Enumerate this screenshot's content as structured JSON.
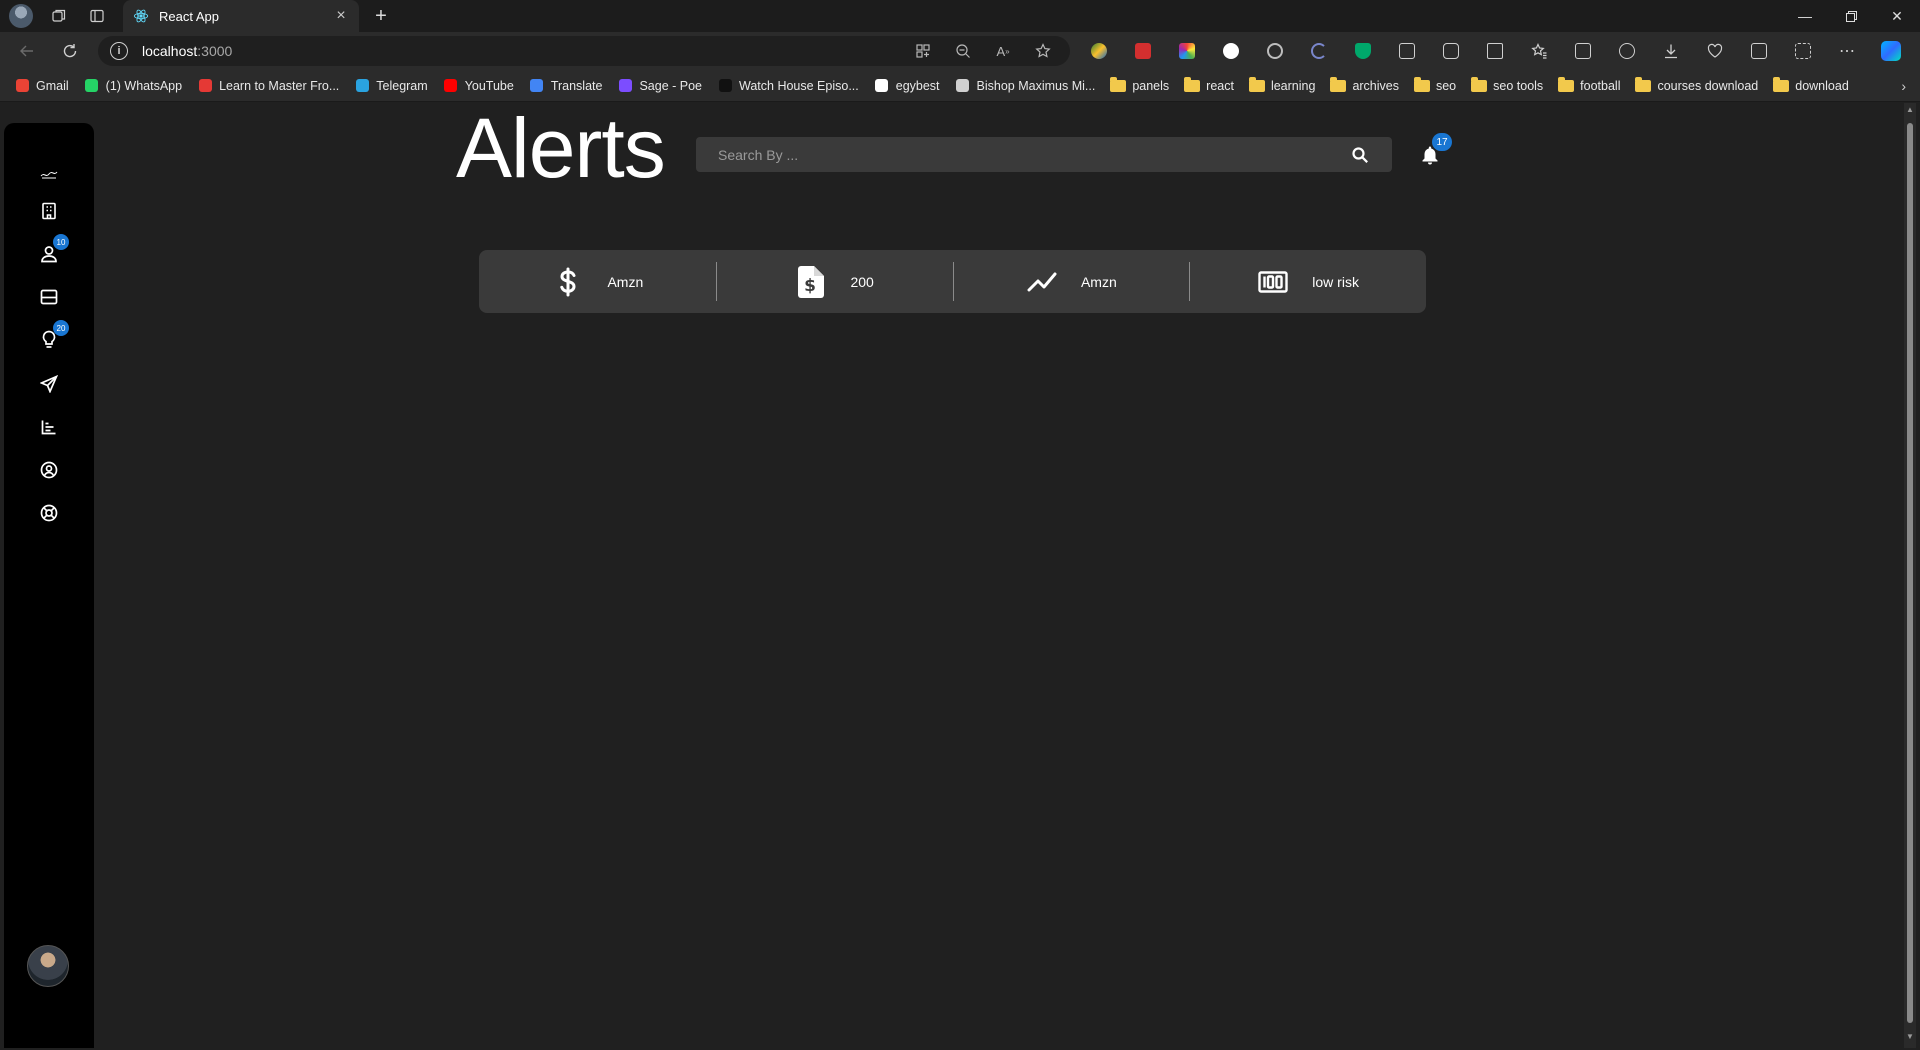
{
  "browser": {
    "tab_title": "React App",
    "url_host": "localhost",
    "url_port": ":3000",
    "bookmarks": [
      {
        "label": "Gmail",
        "icon": "gmail-icon",
        "color": "#ea4335"
      },
      {
        "label": "(1) WhatsApp",
        "icon": "whatsapp-icon",
        "color": "#25d366"
      },
      {
        "label": "Learn to Master Fro...",
        "icon": "frontend-master-icon",
        "color": "#e53935"
      },
      {
        "label": "Telegram",
        "icon": "telegram-icon",
        "color": "#2aa3e0"
      },
      {
        "label": "YouTube",
        "icon": "youtube-icon",
        "color": "#ff0000"
      },
      {
        "label": "Translate",
        "icon": "translate-icon",
        "color": "#4285f4"
      },
      {
        "label": "Sage - Poe",
        "icon": "poe-icon",
        "color": "#7c4dff"
      },
      {
        "label": "Watch House Episo...",
        "icon": "watch-house-icon",
        "color": "#111111"
      },
      {
        "label": "egybest",
        "icon": "egybest-icon",
        "color": "#ffffff"
      },
      {
        "label": "Bishop Maximus Mi...",
        "icon": "page-icon",
        "color": "#d0d0d0"
      },
      {
        "label": "panels",
        "icon": "folder-icon",
        "color": "#f2c94c"
      },
      {
        "label": "react",
        "icon": "folder-icon",
        "color": "#f2c94c"
      },
      {
        "label": "learning",
        "icon": "folder-icon",
        "color": "#f2c94c"
      },
      {
        "label": "archives",
        "icon": "folder-icon",
        "color": "#f2c94c"
      },
      {
        "label": "seo",
        "icon": "folder-icon",
        "color": "#f2c94c"
      },
      {
        "label": "seo tools",
        "icon": "folder-icon",
        "color": "#f2c94c"
      },
      {
        "label": "football",
        "icon": "folder-icon",
        "color": "#f2c94c"
      },
      {
        "label": "courses download",
        "icon": "folder-icon",
        "color": "#f2c94c"
      },
      {
        "label": "download",
        "icon": "folder-icon",
        "color": "#f2c94c"
      }
    ]
  },
  "app": {
    "title": "Alerts",
    "search": {
      "placeholder": "Search By ..."
    },
    "notifications": {
      "count": "17"
    },
    "sidebar": {
      "items": [
        {
          "name": "logo",
          "icon": "logo-icon"
        },
        {
          "name": "buildings",
          "icon": "building-icon"
        },
        {
          "name": "users",
          "icon": "person-icon",
          "badge": "10"
        },
        {
          "name": "inbox",
          "icon": "inbox-icon"
        },
        {
          "name": "ideas",
          "icon": "lightbulb-icon",
          "badge": "20"
        },
        {
          "name": "send",
          "icon": "send-icon"
        },
        {
          "name": "analytics",
          "icon": "bar-chart-icon"
        },
        {
          "name": "account",
          "icon": "account-circle-icon"
        },
        {
          "name": "support",
          "icon": "lifebuoy-icon"
        }
      ]
    },
    "stats": [
      {
        "icon": "dollar-icon",
        "value": "Amzn"
      },
      {
        "icon": "invoice-icon",
        "value": "200"
      },
      {
        "icon": "trend-icon",
        "value": "Amzn"
      },
      {
        "icon": "score-100-icon",
        "value": "low risk"
      }
    ],
    "accent_color": "#1976d2"
  }
}
